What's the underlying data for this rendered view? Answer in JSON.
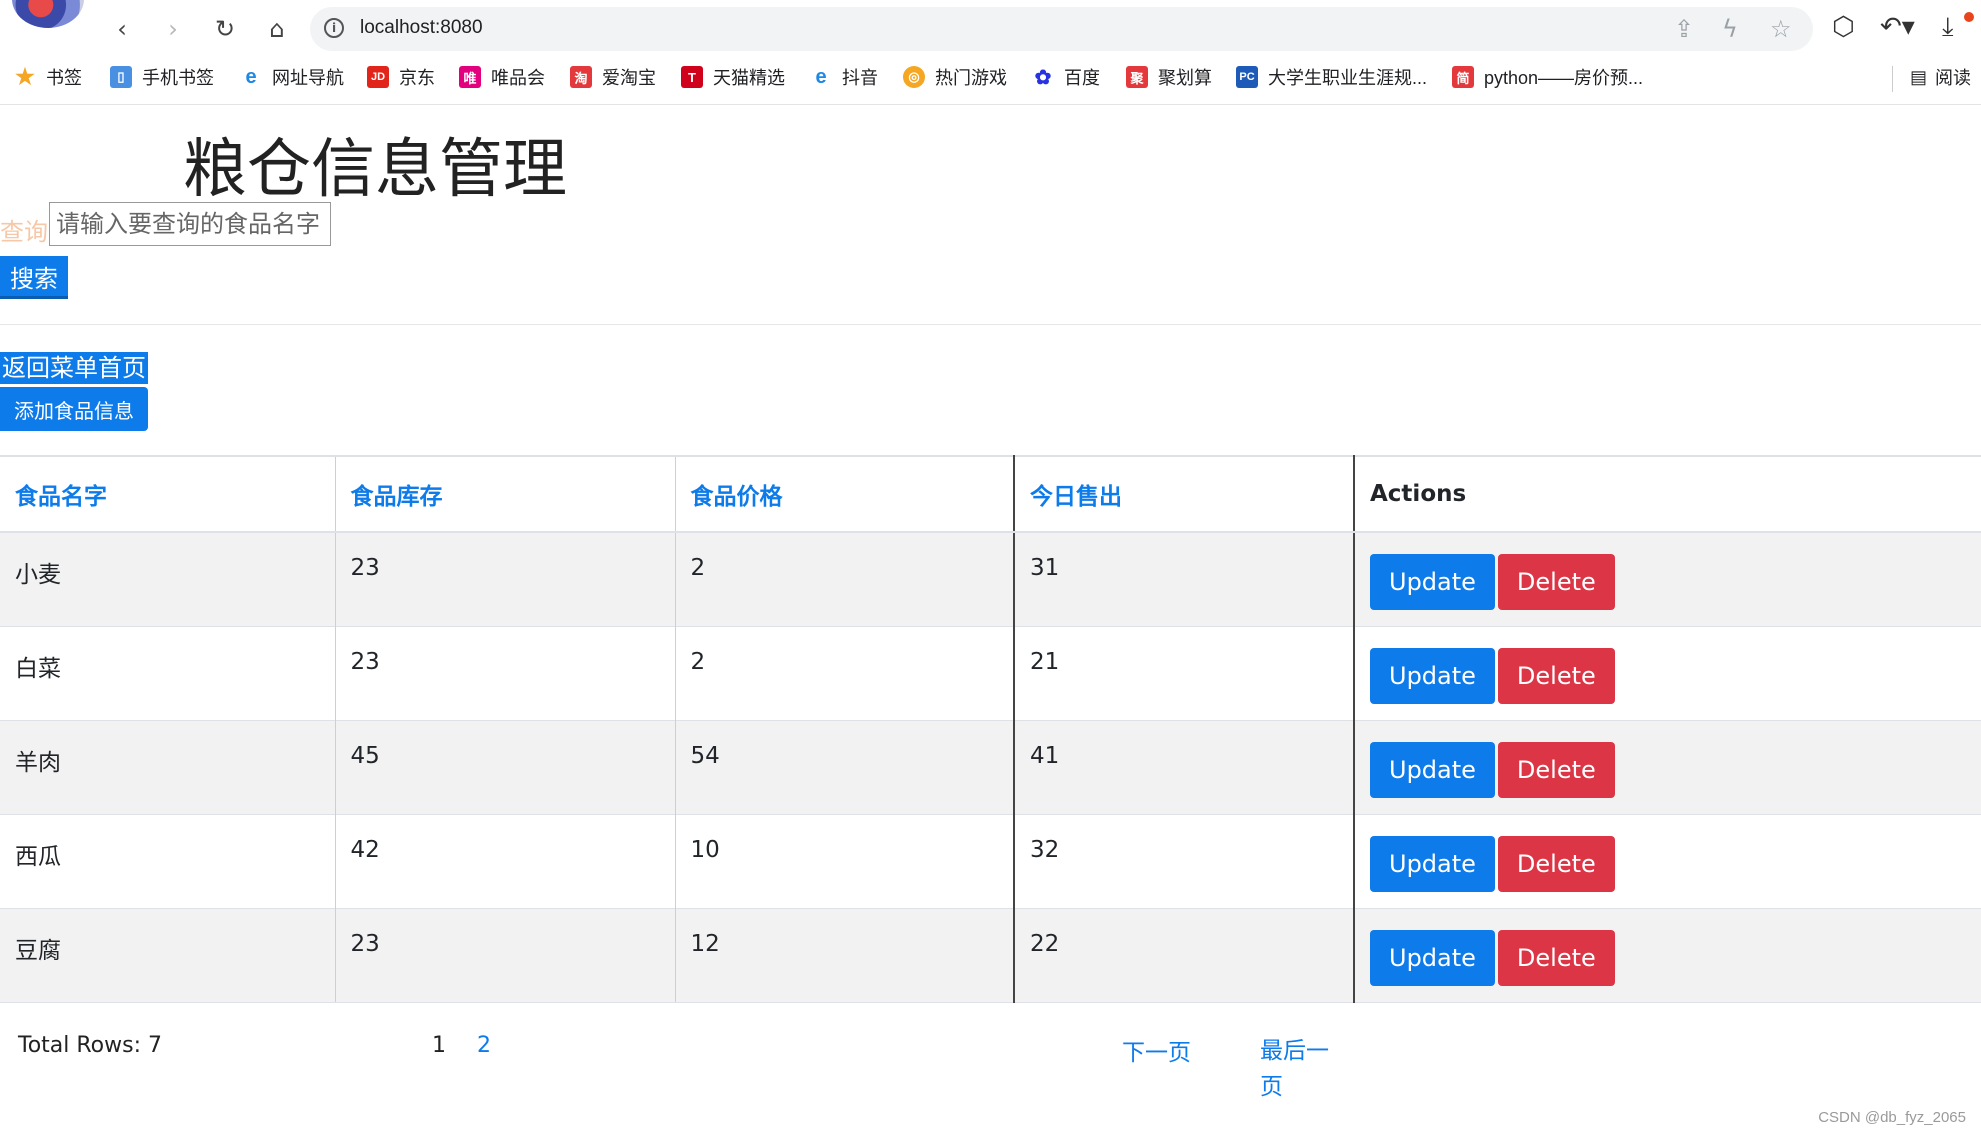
{
  "browser": {
    "url": "localhost:8080",
    "bookmarks": [
      {
        "label": "书签",
        "icon": "star-icon",
        "color": "#f5a623",
        "glyph": "★"
      },
      {
        "label": "手机书签",
        "icon": "phone-icon",
        "color": "#4a90e2",
        "glyph": "▯"
      },
      {
        "label": "网址导航",
        "icon": "ie-icon",
        "color": "#1e88e5",
        "glyph": "e"
      },
      {
        "label": "京东",
        "icon": "jd-icon",
        "color": "#e1251b",
        "glyph": "JD"
      },
      {
        "label": "唯品会",
        "icon": "vip-icon",
        "color": "#e3007f",
        "glyph": "唯"
      },
      {
        "label": "爱淘宝",
        "icon": "taobao-icon",
        "color": "#e4393c",
        "glyph": "淘"
      },
      {
        "label": "天猫精选",
        "icon": "tmall-icon",
        "color": "#d0021b",
        "glyph": "T"
      },
      {
        "label": "抖音",
        "icon": "ie-icon",
        "color": "#1e88e5",
        "glyph": "e"
      },
      {
        "label": "热门游戏",
        "icon": "game-icon",
        "color": "#f5a623",
        "glyph": "◎"
      },
      {
        "label": "百度",
        "icon": "baidu-icon",
        "color": "#2932e1",
        "glyph": "✿"
      },
      {
        "label": "聚划算",
        "icon": "juhuasuan-icon",
        "color": "#e4393c",
        "glyph": "聚"
      },
      {
        "label": "大学生职业生涯规...",
        "icon": "pc-icon",
        "color": "#1e5bb8",
        "glyph": "PC"
      },
      {
        "label": "python——房价预...",
        "icon": "jian-icon",
        "color": "#e4393c",
        "glyph": "简"
      }
    ],
    "reading_label": "阅读"
  },
  "page": {
    "title": "粮仓信息管理",
    "query_label": "查询",
    "search_placeholder": "请输入要查询的食品名字",
    "search_button": "搜索",
    "back_link": "返回菜单首页",
    "add_button": "添加食品信息"
  },
  "table": {
    "headers": [
      "食品名字",
      "食品库存",
      "食品价格",
      "今日售出",
      "Actions"
    ],
    "rows": [
      {
        "name": "小麦",
        "stock": "23",
        "price": "2",
        "sold": "31"
      },
      {
        "name": "白菜",
        "stock": "23",
        "price": "2",
        "sold": "21"
      },
      {
        "name": "羊肉",
        "stock": "45",
        "price": "54",
        "sold": "41"
      },
      {
        "name": "西瓜",
        "stock": "42",
        "price": "10",
        "sold": "32"
      },
      {
        "name": "豆腐",
        "stock": "23",
        "price": "12",
        "sold": "22"
      }
    ],
    "update_label": "Update",
    "delete_label": "Delete"
  },
  "pagination": {
    "total_rows": "Total Rows: 7",
    "page_1": "1",
    "page_2": "2",
    "next": "下一页",
    "last": "最后一页"
  },
  "watermark": "CSDN @db_fyz_2065",
  "colors": {
    "primary": "#0d7bea",
    "danger": "#dc3545"
  }
}
